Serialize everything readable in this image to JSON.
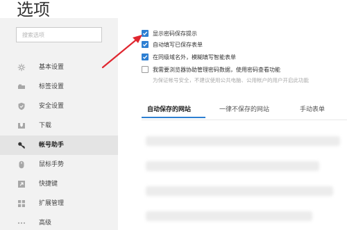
{
  "title": "选项",
  "search": {
    "placeholder": "搜索选项"
  },
  "sidebar": {
    "items": [
      {
        "label": "基本设置",
        "icon": "gear-icon",
        "active": false
      },
      {
        "label": "标签设置",
        "icon": "tab-icon",
        "active": false
      },
      {
        "label": "安全设置",
        "icon": "shield-icon",
        "active": false
      },
      {
        "label": "下载",
        "icon": "download-icon",
        "active": false
      },
      {
        "label": "帐号助手",
        "icon": "key-icon",
        "active": true
      },
      {
        "label": "鼠标手势",
        "icon": "mouse-icon",
        "active": false
      },
      {
        "label": "快捷键",
        "icon": "shortcut-icon",
        "active": false
      },
      {
        "label": "扩展管理",
        "icon": "grid-icon",
        "active": false
      },
      {
        "label": "高级",
        "icon": "more-icon",
        "active": false
      }
    ]
  },
  "options": [
    {
      "label": "显示密码保存提示",
      "checked": true
    },
    {
      "label": "自动填写已保存表单",
      "checked": true
    },
    {
      "label": "在同级域名外，模糊填写智能表单",
      "checked": true
    },
    {
      "label": "我需要浏览器协助管理密码数据，使用密码查看功能",
      "checked": false
    }
  ],
  "options_hint": "为保证帐号安全，不建议使用公共电脑、公用帐户的用户开启此功能",
  "tabs": [
    {
      "label": "自动保存的网站",
      "active": true
    },
    {
      "label": "一律不保存的网站",
      "active": false
    },
    {
      "label": "手动表单",
      "active": false
    }
  ],
  "colors": {
    "accent": "#2d7fd2",
    "arrow": "#e0262f",
    "sidebar_bg": "#f2f2f2"
  }
}
